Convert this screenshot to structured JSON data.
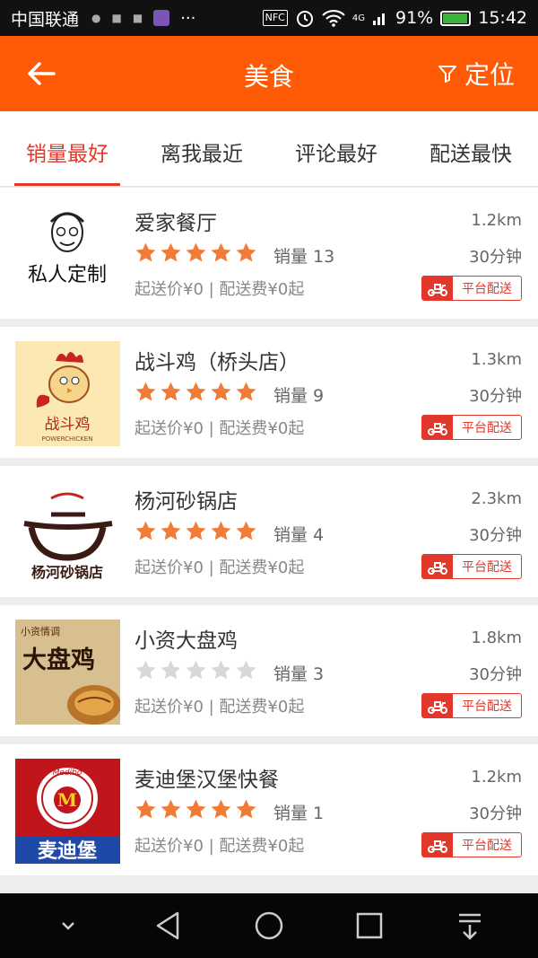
{
  "status_bar": {
    "carrier": "中国联通",
    "nfc": "NFC",
    "network": "4G",
    "battery": "91%",
    "time": "15:42"
  },
  "header": {
    "title": "美食",
    "locate_label": "定位"
  },
  "tabs": [
    {
      "label": "销量最好",
      "active": true
    },
    {
      "label": "离我最近",
      "active": false
    },
    {
      "label": "评论最好",
      "active": false
    },
    {
      "label": "配送最快",
      "active": false
    }
  ],
  "restaurants": [
    {
      "name": "爱家餐厅",
      "rating": 5,
      "sales": "销量 13",
      "fees": "起送价¥0 | 配送费¥0起",
      "distance": "1.2km",
      "time": "30分钟",
      "badge": "平台配送",
      "logo_icon": "chef-caricature-logo"
    },
    {
      "name": "战斗鸡（桥头店）",
      "rating": 5,
      "sales": "销量 9",
      "fees": "起送价¥0 | 配送费¥0起",
      "distance": "1.3km",
      "time": "30分钟",
      "badge": "平台配送",
      "logo_icon": "rooster-logo"
    },
    {
      "name": "杨河砂锅店",
      "rating": 5,
      "sales": "销量 4",
      "fees": "起送价¥0 | 配送费¥0起",
      "distance": "2.3km",
      "time": "30分钟",
      "badge": "平台配送",
      "logo_icon": "clay-pot-logo"
    },
    {
      "name": "小资大盘鸡",
      "rating": 0,
      "sales": "销量 3",
      "fees": "起送价¥0 | 配送费¥0起",
      "distance": "1.8km",
      "time": "30分钟",
      "badge": "平台配送",
      "logo_icon": "dapanji-logo"
    },
    {
      "name": "麦迪堡汉堡快餐",
      "rating": 5,
      "sales": "销量 1",
      "fees": "起送价¥0 | 配送费¥0起",
      "distance": "1.2km",
      "time": "30分钟",
      "badge": "平台配送",
      "logo_icon": "medibo-logo"
    }
  ],
  "logo_texts": {
    "chef": "私人定制",
    "rooster": "战斗鸡",
    "rooster_sub": "POWERCHICKEN",
    "pot": "杨河砂锅店",
    "dapanji_top": "小资情调",
    "dapanji_main": "大盘鸡",
    "medibo_letter": "M",
    "medibo_name": "麦迪堡",
    "medibo_brand": "Medibo"
  },
  "colors": {
    "accent": "#ff5a05",
    "active_tab": "#e2382b",
    "star_on": "#f07c38",
    "star_off": "#d8d8d8"
  }
}
